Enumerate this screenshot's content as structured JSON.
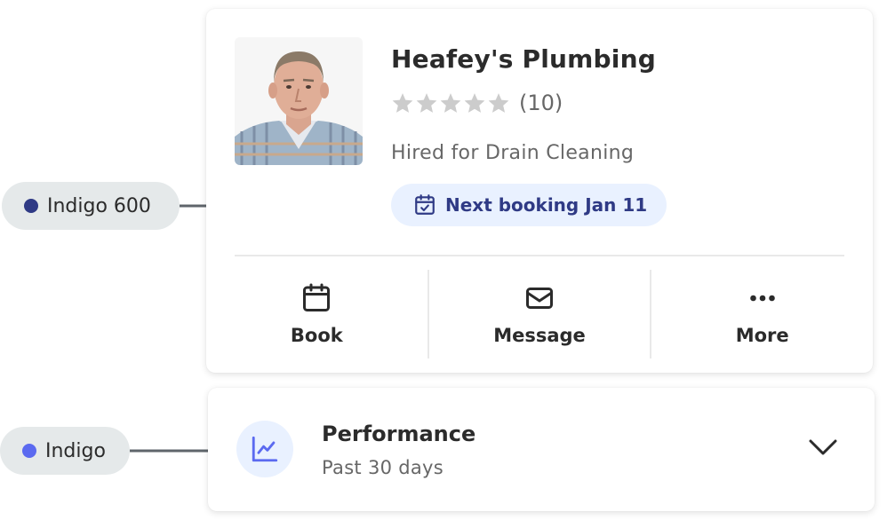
{
  "colors": {
    "indigo_600": "#2f3a85",
    "indigo": "#5b6af0",
    "pill_bg": "#e9f1ff",
    "star_empty": "#cccccc",
    "callout_bg": "#e5e9ea",
    "connector": "#5f656b"
  },
  "pro_card": {
    "name": "Heafey's Plumbing",
    "rating_stars": 0,
    "max_stars": 5,
    "review_count": "(10)",
    "hired_for": "Hired for Drain Cleaning",
    "booking": {
      "label": "Next booking Jan 11",
      "icon": "calendar-check-icon"
    },
    "actions": [
      {
        "label": "Book",
        "icon": "calendar-icon"
      },
      {
        "label": "Message",
        "icon": "envelope-icon"
      },
      {
        "label": "More",
        "icon": "more-dots-icon"
      }
    ]
  },
  "performance_card": {
    "title": "Performance",
    "subtitle": "Past 30 days",
    "icon": "line-chart-icon",
    "toggle_icon": "chevron-down-icon"
  },
  "callouts": [
    {
      "label": "Indigo 600",
      "color": "#2f3a85"
    },
    {
      "label": "Indigo",
      "color": "#5b6af0"
    }
  ]
}
